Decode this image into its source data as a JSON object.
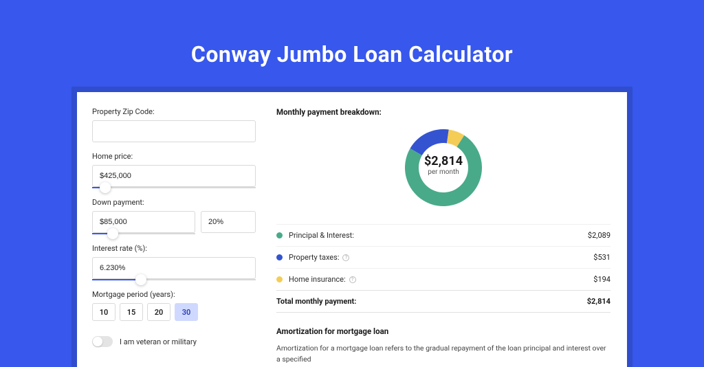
{
  "colors": {
    "green": "#49aa8a",
    "blue": "#3453d1",
    "yellow": "#f4cd57"
  },
  "title": "Conway Jumbo Loan Calculator",
  "form": {
    "zip_label": "Property Zip Code:",
    "zip_value": "",
    "homeprice_label": "Home price:",
    "homeprice_value": "$425,000",
    "homeprice_pct": 8,
    "down_label": "Down payment:",
    "down_value": "$85,000",
    "down_pct_value": "20%",
    "down_slider_pct": 20,
    "rate_label": "Interest rate (%):",
    "rate_value": "6.230%",
    "rate_slider_pct": 30,
    "period_label": "Mortgage period (years):",
    "periods": [
      "10",
      "15",
      "20",
      "30"
    ],
    "period_selected_index": 3,
    "veteran_label": "I am veteran or military"
  },
  "breakdown": {
    "title": "Monthly payment breakdown:",
    "center_value": "$2,814",
    "center_sub": "per month",
    "rows": [
      {
        "color": "green",
        "label": "Principal & Interest:",
        "value": "$2,089",
        "info": false
      },
      {
        "color": "blue",
        "label": "Property taxes:",
        "value": "$531",
        "info": true
      },
      {
        "color": "yellow",
        "label": "Home insurance:",
        "value": "$194",
        "info": true
      }
    ],
    "total_label": "Total monthly payment:",
    "total_value": "$2,814"
  },
  "amort": {
    "title": "Amortization for mortgage loan",
    "text": "Amortization for a mortgage loan refers to the gradual repayment of the loan principal and interest over a specified"
  },
  "chart_data": {
    "type": "pie",
    "title": "Monthly payment breakdown",
    "series": [
      {
        "name": "Principal & Interest",
        "value": 2089,
        "color": "#49aa8a"
      },
      {
        "name": "Property taxes",
        "value": 531,
        "color": "#3453d1"
      },
      {
        "name": "Home insurance",
        "value": 194,
        "color": "#f4cd57"
      }
    ],
    "total": 2814,
    "unit": "USD/month"
  }
}
